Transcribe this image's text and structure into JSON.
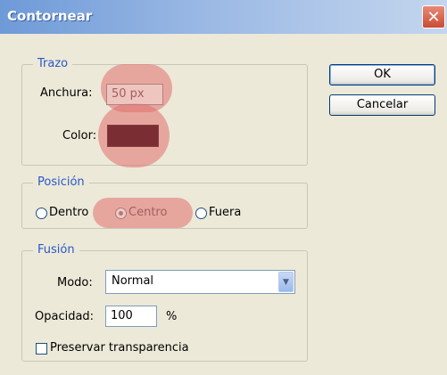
{
  "window": {
    "title": "Contornear",
    "close_symbol": "✕"
  },
  "trazo": {
    "legend": "Trazo",
    "anchura_label": "Anchura:",
    "anchura_value": "50 px",
    "color_label": "Color:",
    "color_value": "#7a2e34"
  },
  "posicion": {
    "legend": "Posición",
    "options": [
      {
        "label": "Dentro",
        "selected": false
      },
      {
        "label": "Centro",
        "selected": true
      },
      {
        "label": "Fuera",
        "selected": false
      }
    ]
  },
  "fusion": {
    "legend": "Fusión",
    "modo_label": "Modo:",
    "modo_value": "Normal",
    "opacidad_label": "Opacidad:",
    "opacidad_value": "100",
    "opacidad_unit": "%",
    "preservar_label": "Preservar transparencia",
    "preservar_checked": false
  },
  "buttons": {
    "ok": "OK",
    "cancel": "Cancelar"
  },
  "colors": {
    "highlight": "#e27070",
    "legend_text": "#2a58c8"
  }
}
